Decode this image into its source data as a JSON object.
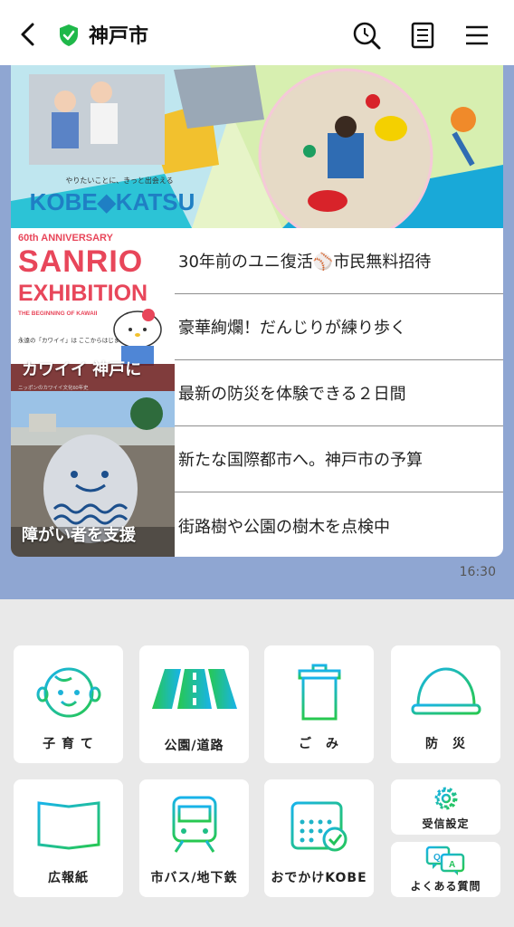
{
  "header": {
    "title": "神戸市",
    "icons": [
      "chevron-left-icon",
      "shield-check-icon",
      "search-icon",
      "notes-icon",
      "menu-icon"
    ]
  },
  "banner": {
    "logo_text": "KOBE◆KATSU",
    "tagline": "やりたいことに、きっと出会える"
  },
  "thumbs": [
    {
      "caption": "カワイイ 神戸に",
      "poster_title_1": "60th ANNIVERSARY",
      "poster_title_2": "SANRIO",
      "poster_title_3": "EXHIBITION",
      "poster_sub": "THE BEGINNING OF KAWAII",
      "poster_note": "永遠の「カワイイ」は ここからはじまった",
      "poster_foot": "ニッポンのカワイイ文化60年史"
    },
    {
      "caption": "障がい者を支援"
    }
  ],
  "articles": [
    "30年前のユニ復活⚾市民無料招待",
    "豪華絢爛！だんじりが練り歩く",
    "最新の防災を体験できる２日間",
    "新たな国際都市へ。神戸市の予算",
    "街路樹や公園の樹木を点検中"
  ],
  "timestamp": "16:30",
  "menu": {
    "items": [
      {
        "label": "子 育 て",
        "icon": "baby-face-icon"
      },
      {
        "label": "公園/道路",
        "icon": "road-icon"
      },
      {
        "label": "ご　み",
        "icon": "trash-can-icon"
      },
      {
        "label": "防　災",
        "icon": "helmet-icon"
      },
      {
        "label": "広報紙",
        "icon": "newspaper-icon"
      },
      {
        "label": "市バス/地下鉄",
        "icon": "train-icon"
      },
      {
        "label": "おでかけKOBE",
        "icon": "calendar-check-icon"
      },
      {
        "label": "受信設定",
        "icon": "gear-icon"
      },
      {
        "label": "よくある質問",
        "icon": "qa-bubble-icon"
      }
    ]
  },
  "colors": {
    "accent_green": "#22c25a",
    "accent_cyan": "#17b6e6",
    "chat_bg": "#8fa6d2"
  }
}
